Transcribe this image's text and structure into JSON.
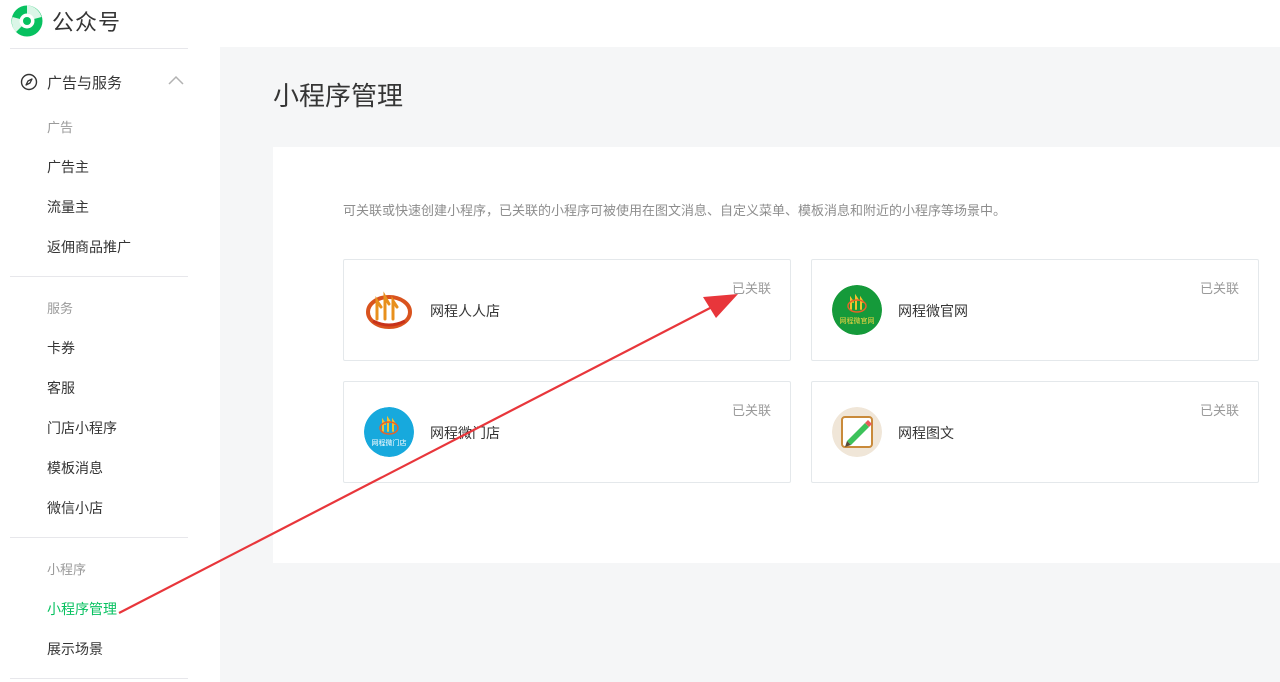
{
  "header": {
    "logo_text": "公众号",
    "logo_icon": "wechat-official-account-logo"
  },
  "sidebar": {
    "group": {
      "title": "广告与服务",
      "icon": "compass-icon",
      "expanded": true
    },
    "sections": [
      {
        "label": "广告",
        "items": [
          "广告主",
          "流量主",
          "返佣商品推广"
        ]
      },
      {
        "label": "服务",
        "items": [
          "卡券",
          "客服",
          "门店小程序",
          "模板消息",
          "微信小店"
        ]
      },
      {
        "label": "小程序",
        "items": [
          "小程序管理",
          "展示场景"
        ]
      }
    ],
    "active_item": "小程序管理"
  },
  "main": {
    "title": "小程序管理",
    "description": "可关联或快速创建小程序，已关联的小程序可被使用在图文消息、自定义菜单、模板消息和附近的小程序等场景中。",
    "cards": [
      {
        "name": "网程人人店",
        "status": "已关联",
        "avatar_icon": "wangcheng-renrendian-logo"
      },
      {
        "name": "网程微官网",
        "status": "已关联",
        "avatar_icon": "wangcheng-weiguanwang-logo",
        "avatar_caption": "网程微官网"
      },
      {
        "name": "网程微门店",
        "status": "已关联",
        "avatar_icon": "wangcheng-weimendian-logo",
        "avatar_caption": "网程微门店"
      },
      {
        "name": "网程图文",
        "status": "已关联",
        "avatar_icon": "wangcheng-tuwen-logo"
      }
    ]
  },
  "annotation": {
    "color": "#e8363b",
    "icon": "red-arrow-annotation"
  },
  "colors": {
    "accent": "#07c160",
    "muted": "#9a9a9a"
  }
}
